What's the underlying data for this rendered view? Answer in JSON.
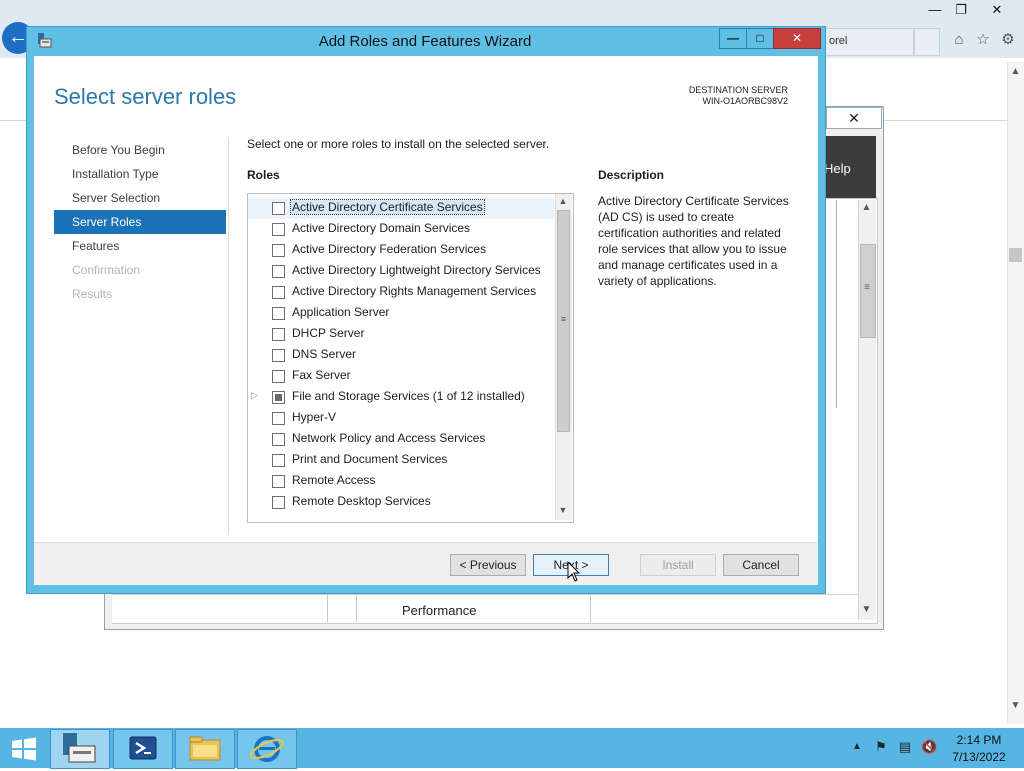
{
  "wizard": {
    "title": "Add Roles and Features Wizard",
    "heading": "Select server roles",
    "destination_label": "DESTINATION SERVER",
    "destination_server": "WIN-O1AORBC98V2",
    "instruction": "Select one or more roles to install on the selected server.",
    "roles_label": "Roles",
    "description_label": "Description",
    "description_text": "Active Directory Certificate Services (AD CS) is used to create certification authorities and related role services that allow you to issue and manage certificates used in a variety of applications.",
    "nav": [
      {
        "label": "Before You Begin",
        "state": "normal"
      },
      {
        "label": "Installation Type",
        "state": "normal"
      },
      {
        "label": "Server Selection",
        "state": "normal"
      },
      {
        "label": "Server Roles",
        "state": "selected"
      },
      {
        "label": "Features",
        "state": "normal"
      },
      {
        "label": "Confirmation",
        "state": "disabled"
      },
      {
        "label": "Results",
        "state": "disabled"
      }
    ],
    "roles": [
      {
        "label": "Active Directory Certificate Services",
        "checked": false,
        "selected": true
      },
      {
        "label": "Active Directory Domain Services",
        "checked": false
      },
      {
        "label": "Active Directory Federation Services",
        "checked": false
      },
      {
        "label": "Active Directory Lightweight Directory Services",
        "checked": false
      },
      {
        "label": "Active Directory Rights Management Services",
        "checked": false
      },
      {
        "label": "Application Server",
        "checked": false
      },
      {
        "label": "DHCP Server",
        "checked": false
      },
      {
        "label": "DNS Server",
        "checked": false
      },
      {
        "label": "Fax Server",
        "checked": false
      },
      {
        "label": "File and Storage Services (1 of 12 installed)",
        "checked": "partial",
        "expandable": true
      },
      {
        "label": "Hyper-V",
        "checked": false
      },
      {
        "label": "Network Policy and Access Services",
        "checked": false
      },
      {
        "label": "Print and Document Services",
        "checked": false
      },
      {
        "label": "Remote Access",
        "checked": false
      },
      {
        "label": "Remote Desktop Services",
        "checked": false
      }
    ],
    "buttons": {
      "previous": "< Previous",
      "next": "Next >",
      "install": "Install",
      "cancel": "Cancel"
    }
  },
  "server_manager": {
    "help_label": "Help",
    "performance_label": "Performance"
  },
  "browser": {
    "tab_label_fragment": "orel"
  },
  "taskbar": {
    "time": "2:14 PM",
    "date": "7/13/2022",
    "apps": [
      "server-manager-icon",
      "powershell-icon",
      "file-explorer-icon",
      "internet-explorer-icon"
    ]
  },
  "colors": {
    "wizard_frame": "#5fbfe5",
    "heading_blue": "#2b79a8",
    "nav_selected": "#1c72b8",
    "taskbar": "#57b5e3"
  }
}
